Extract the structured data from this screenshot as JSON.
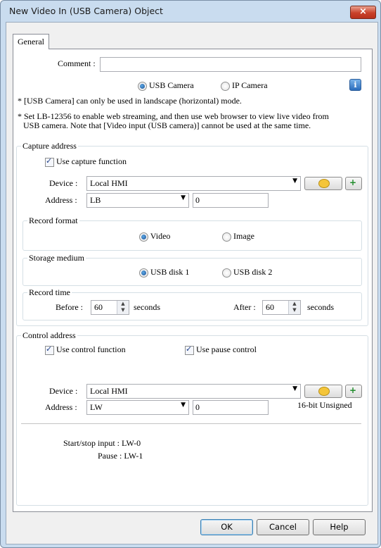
{
  "window": {
    "title": "New Video In (USB Camera) Object",
    "close_icon": "×"
  },
  "tabs": [
    "General"
  ],
  "comment": {
    "label": "Comment :",
    "value": ""
  },
  "source": {
    "option_usb": "USB Camera",
    "option_ip": "IP Camera",
    "selected": "USB Camera",
    "info_icon": "i"
  },
  "notes": [
    "* [USB Camera] can only be used in landscape (horizontal) mode.",
    "* Set LB-12356 to enable web streaming, and then use web browser to view live video from",
    "USB camera. Note that [Video input (USB camera)] cannot be used at the same time."
  ],
  "capture": {
    "title": "Capture address",
    "use_capture_label": "Use capture function",
    "use_capture_checked": true,
    "device_label": "Device :",
    "device_value": "Local HMI",
    "address_label": "Address :",
    "address_type": "LB",
    "address_value": "0",
    "record_format": {
      "title": "Record format",
      "option_video": "Video",
      "option_image": "Image",
      "selected": "Video"
    },
    "storage": {
      "title": "Storage medium",
      "option_1": "USB disk 1",
      "option_2": "USB disk 2",
      "selected": "USB disk 1"
    },
    "record_time": {
      "title": "Record time",
      "before_label": "Before :",
      "before_value": "60",
      "before_unit": "seconds",
      "after_label": "After :",
      "after_value": "60",
      "after_unit": "seconds"
    }
  },
  "control": {
    "title": "Control address",
    "use_control_label": "Use control function",
    "use_control_checked": true,
    "use_pause_label": "Use pause control",
    "use_pause_checked": true,
    "device_label": "Device :",
    "device_value": "Local HMI",
    "address_label": "Address :",
    "address_type": "LW",
    "address_value": "0",
    "data_format": "16-bit Unsigned",
    "start_stop_label": "Start/stop input : LW-0",
    "pause_label": "Pause : LW-1"
  },
  "buttons": {
    "ok": "OK",
    "cancel": "Cancel",
    "help": "Help"
  },
  "colors": {
    "title_bar": "#c9dcef",
    "close": "#c9412a",
    "accent_radio": "#1d4f91"
  }
}
